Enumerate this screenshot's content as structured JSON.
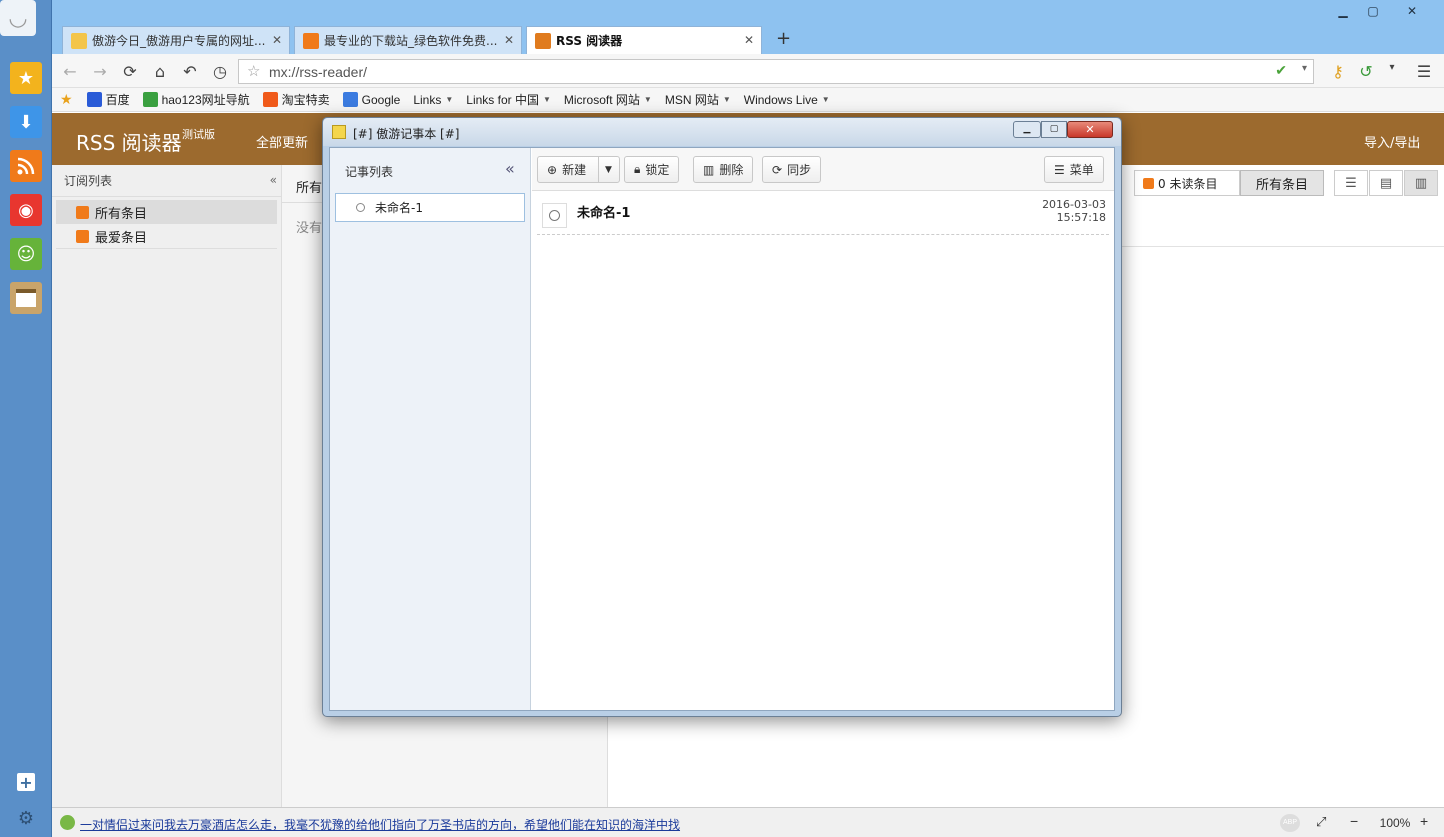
{
  "browser": {
    "tabs": [
      {
        "label": "傲游今日_傲游用户专属的网址..."
      },
      {
        "label": "最专业的下载站_绿色软件免费..."
      },
      {
        "label": "RSS 阅读器"
      }
    ],
    "new_tab": "+",
    "url": "mx://rss-reader/",
    "bookmarks": [
      {
        "label": "百度"
      },
      {
        "label": "hao123网址导航"
      },
      {
        "label": "淘宝特卖"
      },
      {
        "label": "Google"
      },
      {
        "label": "Links"
      },
      {
        "label": "Links for 中国"
      },
      {
        "label": "Microsoft 网站"
      },
      {
        "label": "MSN 网站"
      },
      {
        "label": "Windows Live"
      }
    ]
  },
  "rss": {
    "title": "RSS 阅读器",
    "beta": "测试版",
    "update_all": "全部更新",
    "import_export": "导入/导出",
    "sub_list_title": "订阅列表",
    "feeds": [
      {
        "label": "所有条目"
      },
      {
        "label": "最爱条目"
      }
    ],
    "list_header": "所有",
    "empty_text": "没有",
    "unread_btn": "0 未读条目",
    "all_btn": "所有条目"
  },
  "notepad": {
    "title": "[#] 傲游记事本 [#]",
    "list_title": "记事列表",
    "collapse": "«",
    "notes": [
      {
        "label": "未命名-1"
      }
    ],
    "toolbar": {
      "new": "新建",
      "lock": "锁定",
      "delete": "删除",
      "sync": "同步",
      "menu": "菜单"
    },
    "current_note": {
      "title": "未命名-1",
      "date": "2016-03-03",
      "time": "15:57:18"
    }
  },
  "status": {
    "news_link": "一对情侣过来问我去万豪酒店怎么走，我毫不犹豫的给他们指向了万圣书店的方向，希望他们能在知识的海洋中找",
    "zoom": "100%",
    "zoom_minus": "−",
    "zoom_plus": "+"
  },
  "colors": {
    "rss_header": "#9c6a2e",
    "sidebar": "#5a8fc8",
    "titlebar": "#8ec2f0"
  }
}
